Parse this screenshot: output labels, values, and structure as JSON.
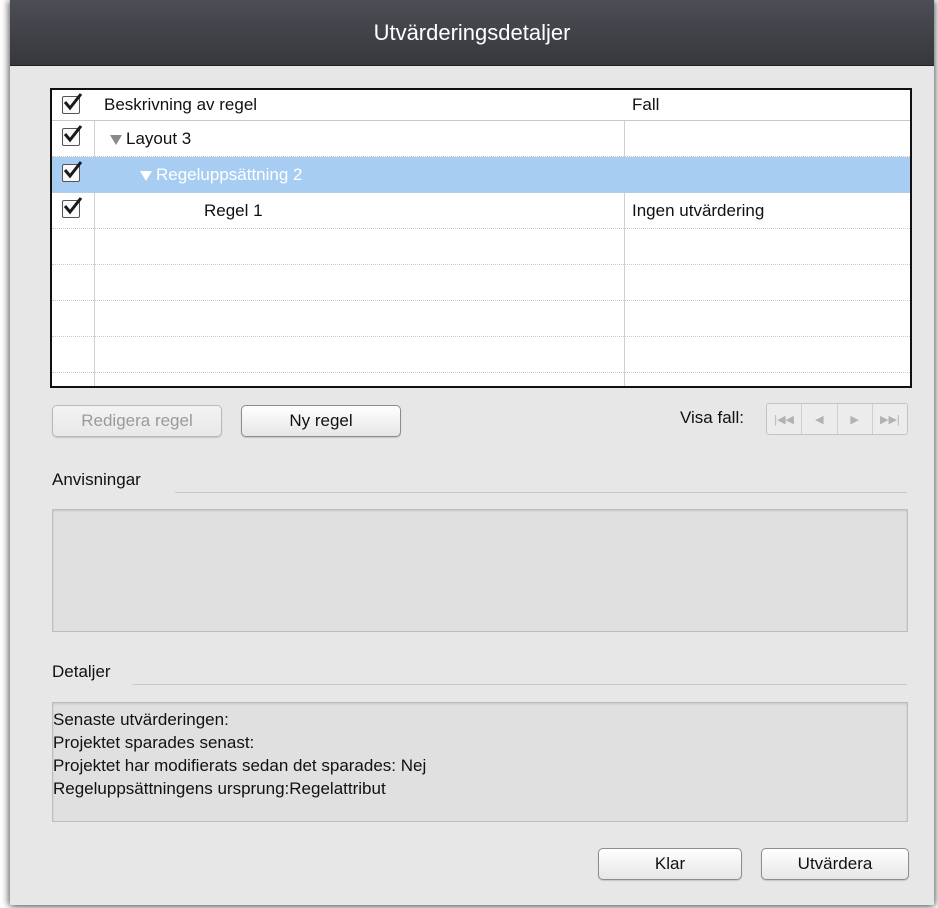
{
  "window": {
    "title": "Utvärderingsdetaljer"
  },
  "table": {
    "headers": {
      "description": "Beskrivning av regel",
      "case": "Fall"
    },
    "rows": [
      {
        "label": "Layout 3",
        "case": "",
        "checked": true,
        "expanded": true
      },
      {
        "label": "Regeluppsättning 2",
        "case": "",
        "checked": true,
        "expanded": true,
        "selected": true
      },
      {
        "label": "Regel 1",
        "case": "Ingen utvärdering",
        "checked": true
      }
    ]
  },
  "buttons": {
    "edit_rule": "Redigera regel",
    "new_rule": "Ny regel",
    "done": "Klar",
    "evaluate": "Utvärdera"
  },
  "visa_fall": {
    "label": "Visa fall:"
  },
  "sections": {
    "instructions": "Anvisningar",
    "details": "Detaljer"
  },
  "details_lines": [
    "Senaste utvärderingen:",
    "Projektet sparades senast:",
    "Projektet har modifierats sedan det sparades: Nej",
    "Regeluppsättningens ursprung:Regelattribut"
  ],
  "colors": {
    "selection": "#a7cdf3",
    "titlebar": "#3f4147"
  }
}
